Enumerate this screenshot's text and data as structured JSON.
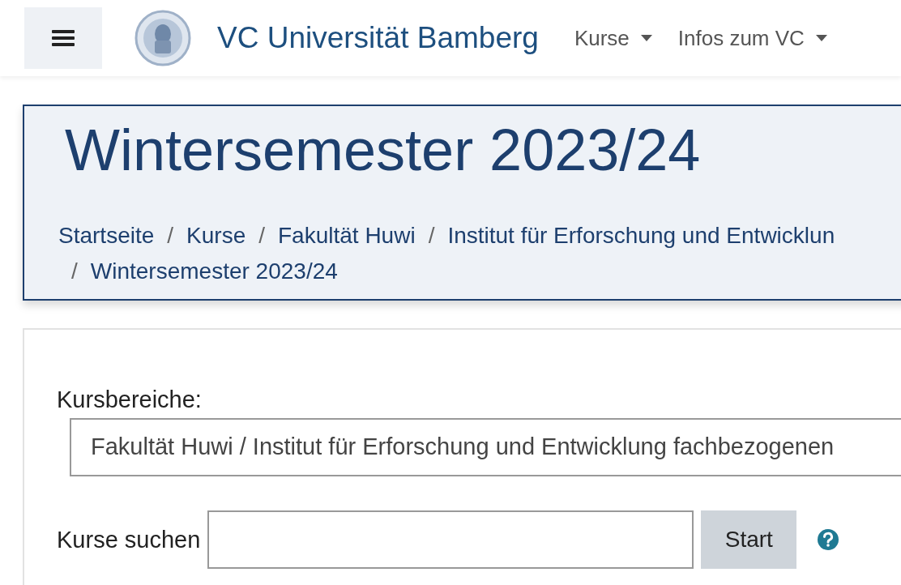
{
  "navbar": {
    "brand": "VC Universität Bamberg",
    "menus": [
      {
        "label": "Kurse"
      },
      {
        "label": "Infos zum VC"
      }
    ]
  },
  "page_header": {
    "title": "Wintersemester 2023/24",
    "breadcrumb": [
      {
        "label": "Startseite"
      },
      {
        "separator": "/",
        "label": "Kurse"
      },
      {
        "separator": "/",
        "label": "Fakultät Huwi"
      },
      {
        "separator": "/",
        "label": "Institut für Erforschung und Entwicklun"
      },
      {
        "separator": "/",
        "label": "Wintersemester 2023/24"
      }
    ]
  },
  "course_categories": {
    "label": "Kursbereiche:",
    "value": "Fakultät Huwi / Institut für Erforschung und Entwicklung fachbezogenen"
  },
  "course_search": {
    "label": "Kurse suchen",
    "button": "Start"
  }
}
